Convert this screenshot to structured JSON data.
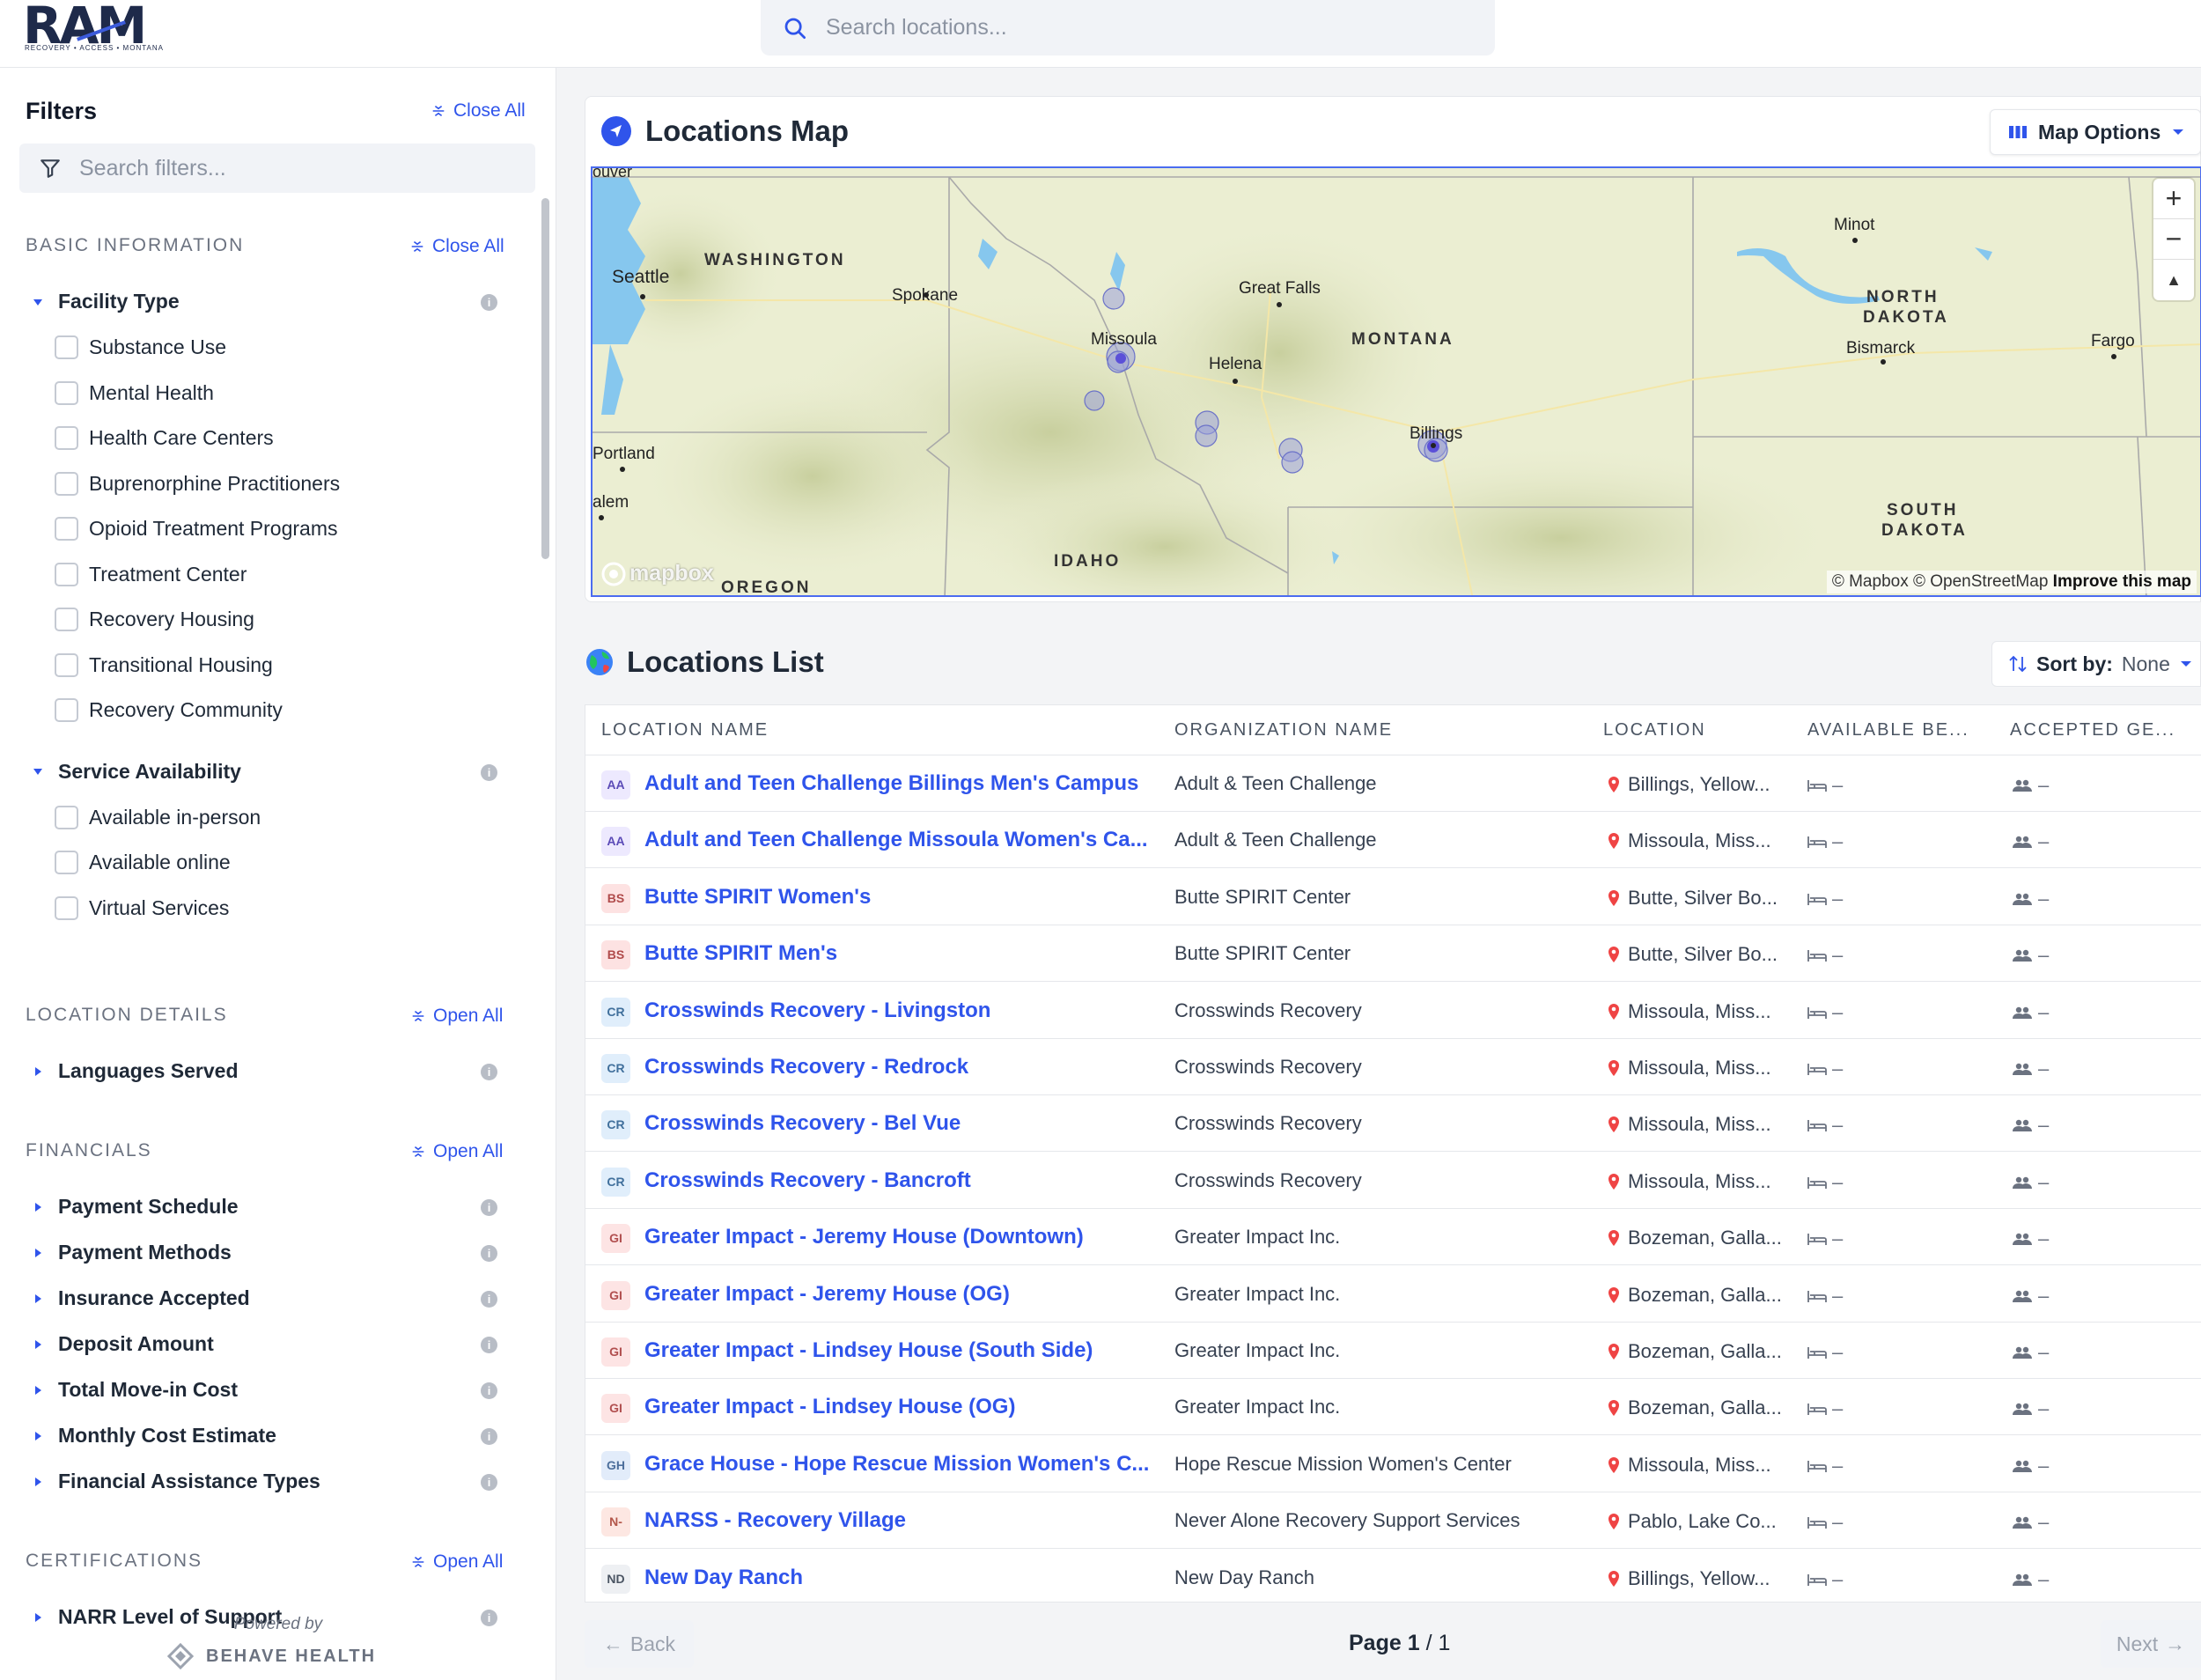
{
  "header": {
    "logo_text": "RAM",
    "logo_tagline": "RECOVERY • ACCESS • MONTANA",
    "search_placeholder": "Search locations..."
  },
  "sidebar": {
    "title": "Filters",
    "close_all": "Close All",
    "search_placeholder": "Search filters...",
    "sections": [
      {
        "title": "BASIC INFORMATION",
        "action": "Close All",
        "groups": [
          {
            "title": "Facility Type",
            "expanded": true,
            "options": [
              "Substance Use",
              "Mental Health",
              "Health Care Centers",
              "Buprenorphine Practitioners",
              "Opioid Treatment Programs",
              "Treatment Center",
              "Recovery Housing",
              "Transitional Housing",
              "Recovery Community"
            ]
          },
          {
            "title": "Service Availability",
            "expanded": true,
            "options": [
              "Available in-person",
              "Available online",
              "Virtual Services"
            ]
          }
        ]
      },
      {
        "title": "LOCATION DETAILS",
        "action": "Open All",
        "groups": [
          {
            "title": "Languages Served",
            "expanded": false
          }
        ]
      },
      {
        "title": "FINANCIALS",
        "action": "Open All",
        "groups": [
          {
            "title": "Payment Schedule",
            "expanded": false
          },
          {
            "title": "Payment Methods",
            "expanded": false
          },
          {
            "title": "Insurance Accepted",
            "expanded": false
          },
          {
            "title": "Deposit Amount",
            "expanded": false
          },
          {
            "title": "Total Move-in Cost",
            "expanded": false
          },
          {
            "title": "Monthly Cost Estimate",
            "expanded": false
          },
          {
            "title": "Financial Assistance Types",
            "expanded": false
          }
        ]
      },
      {
        "title": "CERTIFICATIONS",
        "action": "Open All",
        "groups": [
          {
            "title": "NARR Level of Support",
            "expanded": false
          }
        ]
      }
    ],
    "powered_by": "Powered by",
    "powered_brand": "BEHAVE HEALTH"
  },
  "map": {
    "title": "Locations Map",
    "options_label": "Map Options",
    "labels": {
      "states": [
        "WASHINGTON",
        "MONTANA",
        "NORTH",
        "DAKOTA",
        "SOUTH",
        "DAKOTA",
        "IDAHO",
        "OREGON"
      ],
      "cities": [
        "Seattle",
        "Spokane",
        "Missoula",
        "Great Falls",
        "Helena",
        "Billings",
        "Portland",
        "alem",
        "Minot",
        "Bismarck",
        "Fargo",
        "ouver"
      ]
    },
    "logo": "mapbox",
    "attribution": "© Mapbox © OpenStreetMap",
    "improve": "Improve this map",
    "zoom_in": "+",
    "zoom_out": "−",
    "compass": "▲"
  },
  "list": {
    "title": "Locations List",
    "sort_label": "Sort by:",
    "sort_value": "None",
    "columns": [
      "LOCATION NAME",
      "ORGANIZATION NAME",
      "LOCATION",
      "AVAILABLE BE...",
      "ACCEPTED GE..."
    ],
    "rows": [
      {
        "badge": "AA",
        "badge_bg": "#ede9fe",
        "badge_fg": "#5b4bb7",
        "name": "Adult and Teen Challenge Billings Men's Campus",
        "org": "Adult & Teen Challenge",
        "location": "Billings, Yellow...",
        "beds": "–",
        "gender": "–"
      },
      {
        "badge": "AA",
        "badge_bg": "#ede9fe",
        "badge_fg": "#5b4bb7",
        "name": "Adult and Teen Challenge Missoula Women's Ca...",
        "org": "Adult & Teen Challenge",
        "location": "Missoula, Miss...",
        "beds": "–",
        "gender": "–"
      },
      {
        "badge": "BS",
        "badge_bg": "#fde2e2",
        "badge_fg": "#b04a4a",
        "name": "Butte SPIRIT Women's",
        "org": "Butte SPIRIT Center",
        "location": "Butte, Silver Bo...",
        "beds": "–",
        "gender": "–"
      },
      {
        "badge": "BS",
        "badge_bg": "#fde2e2",
        "badge_fg": "#b04a4a",
        "name": "Butte SPIRIT Men's",
        "org": "Butte SPIRIT Center",
        "location": "Butte, Silver Bo...",
        "beds": "–",
        "gender": "–"
      },
      {
        "badge": "CR",
        "badge_bg": "#e0eefb",
        "badge_fg": "#41709c",
        "name": "Crosswinds Recovery - Livingston",
        "org": "Crosswinds Recovery",
        "location": "Missoula, Miss...",
        "beds": "–",
        "gender": "–"
      },
      {
        "badge": "CR",
        "badge_bg": "#e0eefb",
        "badge_fg": "#41709c",
        "name": "Crosswinds Recovery - Redrock",
        "org": "Crosswinds Recovery",
        "location": "Missoula, Miss...",
        "beds": "–",
        "gender": "–"
      },
      {
        "badge": "CR",
        "badge_bg": "#e0eefb",
        "badge_fg": "#41709c",
        "name": "Crosswinds Recovery - Bel Vue",
        "org": "Crosswinds Recovery",
        "location": "Missoula, Miss...",
        "beds": "–",
        "gender": "–"
      },
      {
        "badge": "CR",
        "badge_bg": "#e0eefb",
        "badge_fg": "#41709c",
        "name": "Crosswinds Recovery - Bancroft",
        "org": "Crosswinds Recovery",
        "location": "Missoula, Miss...",
        "beds": "–",
        "gender": "–"
      },
      {
        "badge": "GI",
        "badge_bg": "#fde4e4",
        "badge_fg": "#b14f4f",
        "name": "Greater Impact - Jeremy House (Downtown)",
        "org": "Greater Impact Inc.",
        "location": "Bozeman, Galla...",
        "beds": "–",
        "gender": "–"
      },
      {
        "badge": "GI",
        "badge_bg": "#fde4e4",
        "badge_fg": "#b14f4f",
        "name": "Greater Impact - Jeremy House (OG)",
        "org": "Greater Impact Inc.",
        "location": "Bozeman, Galla...",
        "beds": "–",
        "gender": "–"
      },
      {
        "badge": "GI",
        "badge_bg": "#fde4e4",
        "badge_fg": "#b14f4f",
        "name": "Greater Impact - Lindsey House (South Side)",
        "org": "Greater Impact Inc.",
        "location": "Bozeman, Galla...",
        "beds": "–",
        "gender": "–"
      },
      {
        "badge": "GI",
        "badge_bg": "#fde4e4",
        "badge_fg": "#b14f4f",
        "name": "Greater Impact - Lindsey House (OG)",
        "org": "Greater Impact Inc.",
        "location": "Bozeman, Galla...",
        "beds": "–",
        "gender": "–"
      },
      {
        "badge": "GH",
        "badge_bg": "#e2ecfa",
        "badge_fg": "#4d6f9c",
        "name": "Grace House - Hope Rescue Mission Women's C...",
        "org": "Hope Rescue Mission Women's Center",
        "location": "Missoula, Miss...",
        "beds": "–",
        "gender": "–"
      },
      {
        "badge": "N-",
        "badge_bg": "#fde7e2",
        "badge_fg": "#b3574a",
        "name": "NARSS - Recovery Village",
        "org": "Never Alone Recovery Support Services",
        "location": "Pablo, Lake Co...",
        "beds": "–",
        "gender": "–"
      },
      {
        "badge": "ND",
        "badge_bg": "#eef0f3",
        "badge_fg": "#4b5563",
        "name": "New Day Ranch",
        "org": "New Day Ranch",
        "location": "Billings, Yellow...",
        "beds": "–",
        "gender": "–"
      }
    ]
  },
  "pagination": {
    "back": "Back",
    "next": "Next",
    "page_word": "Page",
    "current": "1",
    "total": "/ 1"
  },
  "colors": {
    "accent": "#2f54eb",
    "pin": "#ef4444"
  }
}
